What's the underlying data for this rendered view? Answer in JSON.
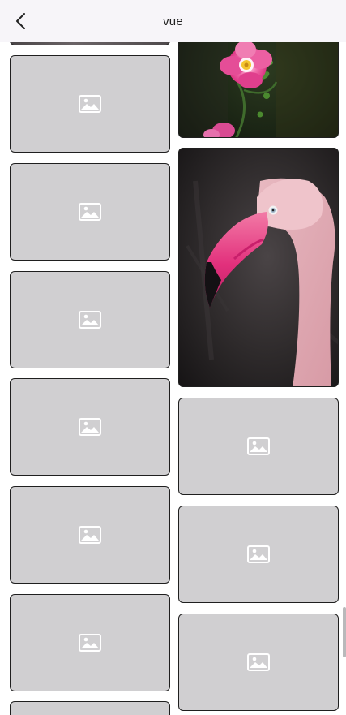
{
  "header": {
    "title": "vue",
    "back_icon": "chevron-left-icon"
  },
  "placeholder_icon": "image-placeholder-icon",
  "colors": {
    "card_bg": "#d0cfd1",
    "card_border": "#1f1f1f",
    "header_bg": "#f7f5f9",
    "accent_pink": "#e2307c"
  }
}
